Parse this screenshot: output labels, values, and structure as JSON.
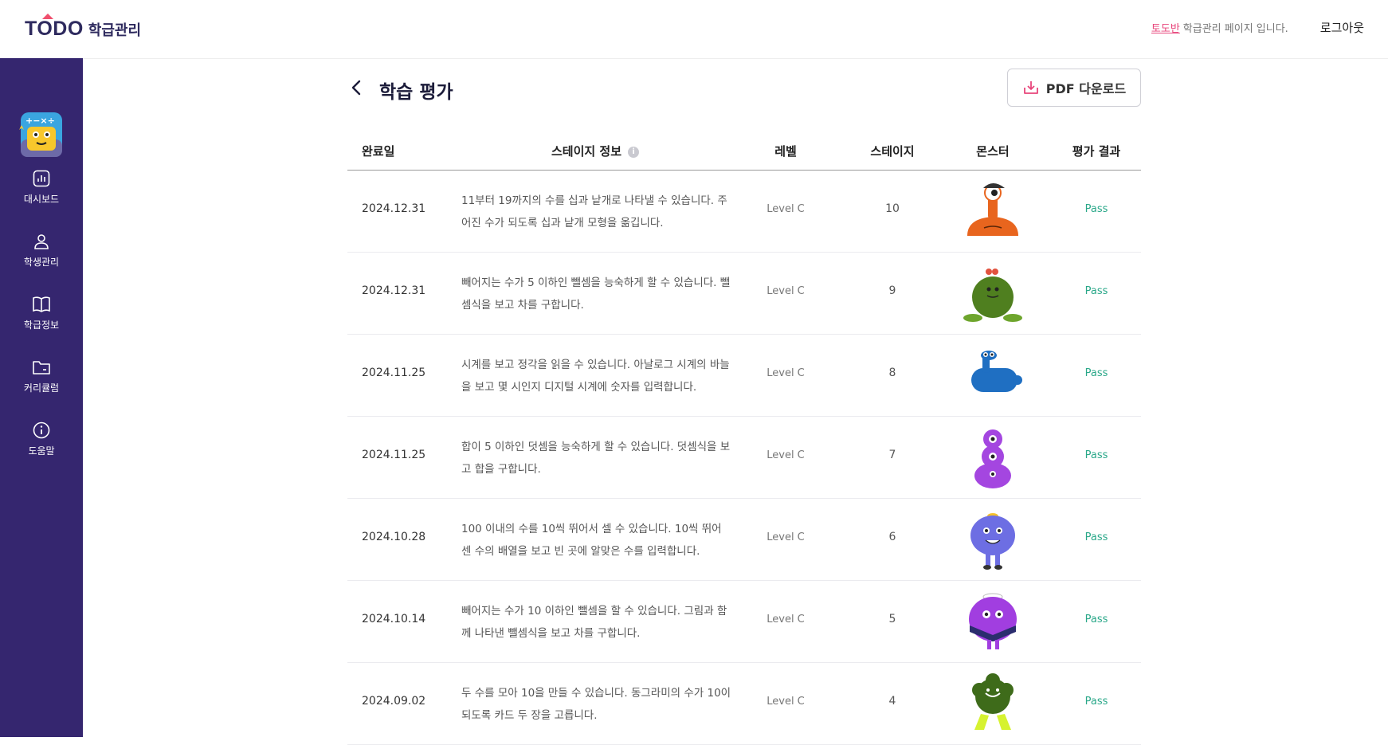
{
  "header": {
    "logo_text": "TODO",
    "logo_sub": "학급관리",
    "class_name": "토도반",
    "message": "학급관리 페이지 입니다.",
    "logout_label": "로그아웃"
  },
  "sidebar": {
    "items": [
      {
        "label": "대시보드",
        "icon": "chart-icon"
      },
      {
        "label": "학생관리",
        "icon": "user-icon"
      },
      {
        "label": "학급정보",
        "icon": "book-icon"
      },
      {
        "label": "커리큘럼",
        "icon": "folder-icon"
      },
      {
        "label": "도움말",
        "icon": "info-icon"
      }
    ]
  },
  "page": {
    "title": "학습 평가",
    "pdf_button_label": "PDF 다운로드"
  },
  "table": {
    "columns": [
      "완료일",
      "스테이지 정보",
      "레벨",
      "스테이지",
      "몬스터",
      "평가 결과"
    ],
    "info_glyph": "i",
    "rows": [
      {
        "date": "2024.12.31",
        "desc": "11부터 19까지의 수를 십과 낱개로 나타낼 수 있습니다. 주어진 수가 되도록 십과 낱개 모형을 옮깁니다.",
        "level": "Level C",
        "stage": "10",
        "monster": "orange-eye-monster",
        "result": "Pass"
      },
      {
        "date": "2024.12.31",
        "desc": "빼어지는 수가 5 이하인 뺄셈을 능숙하게 할 수 있습니다. 뺄셈식을 보고 차를 구합니다.",
        "level": "Level C",
        "stage": "9",
        "monster": "green-blob-monster",
        "result": "Pass"
      },
      {
        "date": "2024.11.25",
        "desc": "시계를 보고 정각을 읽을 수 있습니다. 아날로그 시계의 바늘을 보고 몇 시인지 디지털 시계에 숫자를 입력합니다.",
        "level": "Level C",
        "stage": "8",
        "monster": "blue-slug-monster",
        "result": "Pass"
      },
      {
        "date": "2024.11.25",
        "desc": "합이 5 이하인 덧셈을 능숙하게 할 수 있습니다. 덧셈식을 보고 합을 구합니다.",
        "level": "Level C",
        "stage": "7",
        "monster": "purple-stack-monster",
        "result": "Pass"
      },
      {
        "date": "2024.10.28",
        "desc": "100 이내의 수를 10씩 뛰어서 셀 수 있습니다. 10씩 뛰어 센 수의 배열을 보고 빈 곳에 알맞은 수를 입력합니다.",
        "level": "Level C",
        "stage": "6",
        "monster": "periwinkle-monster",
        "result": "Pass"
      },
      {
        "date": "2024.10.14",
        "desc": "빼어지는 수가 10 이하인 뺄셈을 할 수 있습니다. 그림과 함께 나타낸 뺄셈식을 보고 차를 구합니다.",
        "level": "Level C",
        "stage": "5",
        "monster": "sailor-monster",
        "result": "Pass"
      },
      {
        "date": "2024.09.02",
        "desc": "두 수를 모아 10을 만들 수 있습니다. 동그라미의 수가 10이 되도록 카드 두 장을 고릅니다.",
        "level": "Level C",
        "stage": "4",
        "monster": "broccoli-monster",
        "result": "Pass"
      }
    ]
  },
  "colors": {
    "sidebar": "#35266f",
    "accent": "#e8457b",
    "pass": "#2aa889"
  }
}
